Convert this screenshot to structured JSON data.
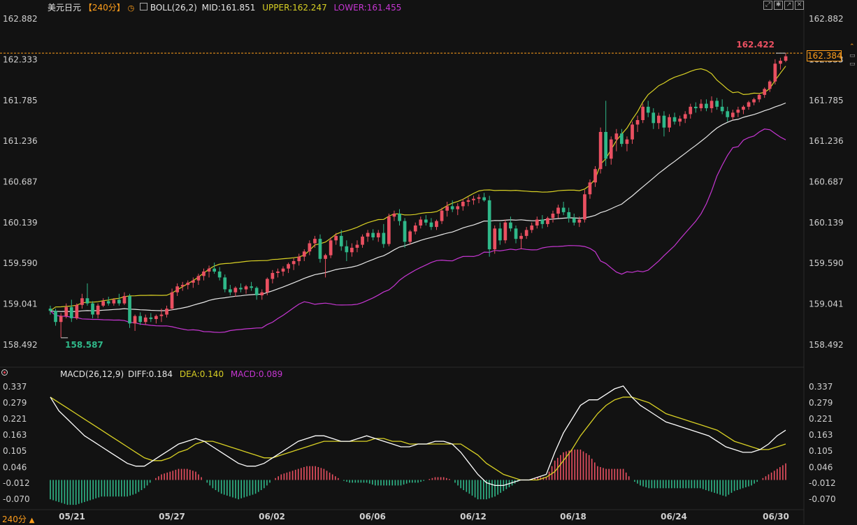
{
  "header": {
    "pair": "美元日元",
    "period": "【240分】",
    "period_icon": "clock-icon",
    "indicator_icon": "indicator-icon",
    "boll": "BOLL(26,2)",
    "mid": "MID:161.851",
    "upper": "UPPER:162.247",
    "lower": "LOWER:161.455"
  },
  "macd_header": {
    "name": "MACD(26,12,9)",
    "diff": "DIFF:0.184",
    "dea": "DEA:0.140",
    "macd": "MACD:0.089"
  },
  "toolbar_icons": [
    "maximize-icon",
    "settings-icon",
    "export-icon",
    "close-icon"
  ],
  "bottom_left": {
    "period": "240分",
    "arrow": "▲"
  },
  "price_axis": [
    "162.882",
    "162.333",
    "161.785",
    "161.236",
    "160.687",
    "160.139",
    "159.590",
    "159.041",
    "158.492"
  ],
  "macd_axis": [
    "0.337",
    "0.279",
    "0.221",
    "0.163",
    "0.105",
    "0.046",
    "-0.012",
    "-0.070"
  ],
  "current_price": "162.384",
  "high_label": "162.422",
  "low_label": "158.587",
  "dates": [
    "05/21",
    "05/27",
    "06/02",
    "06/06",
    "06/12",
    "06/18",
    "06/24",
    "06/30"
  ],
  "colors": {
    "bg": "#121212",
    "up": "#ea5061",
    "down": "#2fb889",
    "mid": "#e8e8e8",
    "upper": "#d8d024",
    "lower": "#c636d2",
    "diff": "#ffffff",
    "dea": "#d8d024",
    "macd_label": "#c636d2",
    "accent": "#ff9e1b"
  },
  "chart_data": [
    {
      "type": "candlestick",
      "title": "美元日元 240分",
      "ylim": [
        158.2,
        162.95
      ],
      "x_ticks": [
        "05/21",
        "05/27",
        "06/02",
        "06/06",
        "06/12",
        "06/18",
        "06/24",
        "06/30"
      ],
      "annotations": {
        "high": 162.422,
        "low": 158.587,
        "last": 162.384
      },
      "boll": {
        "mid": 161.851,
        "upper": 162.247,
        "lower": 161.455
      },
      "candles": [
        [
          158.98,
          159.02,
          158.9,
          158.95
        ],
        [
          158.95,
          158.98,
          158.75,
          158.8
        ],
        [
          158.8,
          158.92,
          158.59,
          158.88
        ],
        [
          158.88,
          159.05,
          158.85,
          159.0
        ],
        [
          159.0,
          159.1,
          158.8,
          158.85
        ],
        [
          158.85,
          159.05,
          158.83,
          159.03
        ],
        [
          159.03,
          159.18,
          158.98,
          159.12
        ],
        [
          159.12,
          159.32,
          159.02,
          159.05
        ],
        [
          159.05,
          159.08,
          158.85,
          158.9
        ],
        [
          158.9,
          159.05,
          158.85,
          159.02
        ],
        [
          159.02,
          159.12,
          159.0,
          159.08
        ],
        [
          159.08,
          159.14,
          159.02,
          159.05
        ],
        [
          159.05,
          159.12,
          159.02,
          159.1
        ],
        [
          159.1,
          159.18,
          159.02,
          159.05
        ],
        [
          159.05,
          159.2,
          159.03,
          159.15
        ],
        [
          159.15,
          159.18,
          158.72,
          158.78
        ],
        [
          158.78,
          158.9,
          158.68,
          158.88
        ],
        [
          158.88,
          158.93,
          158.76,
          158.8
        ],
        [
          158.8,
          158.9,
          158.76,
          158.86
        ],
        [
          158.86,
          158.92,
          158.8,
          158.84
        ],
        [
          158.84,
          158.9,
          158.78,
          158.88
        ],
        [
          158.88,
          158.98,
          158.8,
          158.9
        ],
        [
          158.9,
          159.02,
          158.86,
          158.98
        ],
        [
          158.98,
          159.25,
          158.96,
          159.2
        ],
        [
          159.2,
          159.32,
          159.15,
          159.28
        ],
        [
          159.28,
          159.34,
          159.22,
          159.3
        ],
        [
          159.3,
          159.36,
          159.24,
          159.33
        ],
        [
          159.33,
          159.4,
          159.26,
          159.36
        ],
        [
          159.36,
          159.45,
          159.3,
          159.42
        ],
        [
          159.42,
          159.52,
          159.36,
          159.48
        ],
        [
          159.48,
          159.56,
          159.4,
          159.52
        ],
        [
          159.52,
          159.6,
          159.45,
          159.48
        ],
        [
          159.48,
          159.54,
          159.36,
          159.4
        ],
        [
          159.4,
          159.44,
          159.2,
          159.24
        ],
        [
          159.24,
          159.3,
          159.16,
          159.2
        ],
        [
          159.2,
          159.28,
          159.14,
          159.26
        ],
        [
          159.26,
          159.32,
          159.2,
          159.24
        ],
        [
          159.24,
          159.3,
          159.18,
          159.28
        ],
        [
          159.28,
          159.34,
          159.22,
          159.26
        ],
        [
          159.26,
          159.28,
          159.1,
          159.16
        ],
        [
          159.16,
          159.24,
          159.1,
          159.2
        ],
        [
          159.2,
          159.4,
          159.16,
          159.38
        ],
        [
          159.38,
          159.5,
          159.32,
          159.46
        ],
        [
          159.46,
          159.52,
          159.4,
          159.48
        ],
        [
          159.48,
          159.55,
          159.42,
          159.52
        ],
        [
          159.52,
          159.6,
          159.46,
          159.58
        ],
        [
          159.58,
          159.66,
          159.5,
          159.62
        ],
        [
          159.62,
          159.72,
          159.56,
          159.68
        ],
        [
          159.68,
          159.78,
          159.62,
          159.75
        ],
        [
          159.75,
          159.9,
          159.7,
          159.86
        ],
        [
          159.86,
          159.96,
          159.8,
          159.92
        ],
        [
          159.92,
          159.98,
          159.6,
          159.65
        ],
        [
          159.65,
          159.72,
          159.4,
          159.7
        ],
        [
          159.7,
          159.94,
          159.66,
          159.9
        ],
        [
          159.9,
          160.0,
          159.84,
          159.96
        ],
        [
          159.96,
          160.04,
          159.76,
          159.82
        ],
        [
          159.82,
          159.9,
          159.62,
          159.74
        ],
        [
          159.74,
          159.86,
          159.68,
          159.8
        ],
        [
          159.8,
          159.9,
          159.74,
          159.84
        ],
        [
          159.84,
          159.98,
          159.8,
          159.95
        ],
        [
          159.95,
          160.04,
          159.88,
          160.0
        ],
        [
          160.0,
          160.05,
          159.9,
          159.94
        ],
        [
          159.94,
          160.04,
          159.88,
          160.0
        ],
        [
          160.0,
          160.12,
          159.8,
          159.85
        ],
        [
          159.85,
          160.26,
          159.82,
          160.22
        ],
        [
          160.22,
          160.3,
          160.16,
          160.26
        ],
        [
          160.26,
          160.32,
          160.1,
          160.16
        ],
        [
          160.16,
          160.2,
          159.8,
          159.88
        ],
        [
          159.88,
          160.04,
          159.84,
          160.02
        ],
        [
          160.02,
          160.14,
          159.98,
          160.1
        ],
        [
          160.1,
          160.22,
          160.06,
          160.18
        ],
        [
          160.18,
          160.24,
          160.1,
          160.14
        ],
        [
          160.14,
          160.2,
          160.04,
          160.08
        ],
        [
          160.08,
          160.18,
          160.04,
          160.16
        ],
        [
          160.16,
          160.34,
          160.12,
          160.3
        ],
        [
          160.3,
          160.42,
          160.22,
          160.36
        ],
        [
          160.36,
          160.44,
          160.28,
          160.32
        ],
        [
          160.32,
          160.4,
          160.24,
          160.36
        ],
        [
          160.36,
          160.46,
          160.3,
          160.42
        ],
        [
          160.42,
          160.48,
          160.36,
          160.44
        ],
        [
          160.44,
          160.5,
          160.38,
          160.46
        ],
        [
          160.46,
          160.52,
          160.4,
          160.48
        ],
        [
          160.48,
          160.54,
          160.42,
          160.44
        ],
        [
          160.44,
          160.5,
          159.68,
          159.78
        ],
        [
          159.78,
          160.1,
          159.72,
          160.06
        ],
        [
          160.06,
          160.14,
          159.84,
          159.9
        ],
        [
          159.9,
          160.18,
          159.86,
          160.14
        ],
        [
          160.14,
          160.22,
          160.02,
          160.06
        ],
        [
          160.06,
          160.1,
          159.86,
          159.92
        ],
        [
          159.92,
          160.0,
          159.78,
          159.96
        ],
        [
          159.96,
          160.08,
          159.92,
          160.04
        ],
        [
          160.04,
          160.14,
          160.0,
          160.1
        ],
        [
          160.1,
          160.22,
          160.06,
          160.18
        ],
        [
          160.18,
          160.24,
          160.06,
          160.12
        ],
        [
          160.12,
          160.22,
          160.08,
          160.2
        ],
        [
          160.2,
          160.3,
          160.14,
          160.26
        ],
        [
          160.26,
          160.38,
          160.2,
          160.34
        ],
        [
          160.34,
          160.42,
          160.24,
          160.28
        ],
        [
          160.28,
          160.34,
          160.14,
          160.2
        ],
        [
          160.2,
          160.26,
          160.1,
          160.14
        ],
        [
          160.14,
          160.22,
          160.08,
          160.18
        ],
        [
          160.18,
          160.58,
          160.14,
          160.52
        ],
        [
          160.52,
          160.72,
          160.46,
          160.68
        ],
        [
          160.68,
          160.9,
          160.62,
          160.86
        ],
        [
          160.86,
          161.42,
          160.8,
          161.36
        ],
        [
          161.36,
          161.78,
          160.9,
          161.0
        ],
        [
          161.0,
          161.3,
          160.92,
          161.26
        ],
        [
          161.26,
          161.4,
          161.1,
          161.34
        ],
        [
          161.34,
          161.4,
          161.16,
          161.2
        ],
        [
          161.2,
          161.3,
          161.1,
          161.26
        ],
        [
          161.26,
          161.5,
          161.2,
          161.46
        ],
        [
          161.46,
          161.58,
          161.36,
          161.52
        ],
        [
          161.52,
          161.74,
          161.48,
          161.7
        ],
        [
          161.7,
          161.78,
          161.56,
          161.62
        ],
        [
          161.62,
          161.68,
          161.4,
          161.48
        ],
        [
          161.48,
          161.62,
          161.4,
          161.58
        ],
        [
          161.58,
          161.64,
          161.3,
          161.42
        ],
        [
          161.42,
          161.6,
          161.36,
          161.56
        ],
        [
          161.56,
          161.62,
          161.46,
          161.5
        ],
        [
          161.5,
          161.58,
          161.44,
          161.54
        ],
        [
          161.54,
          161.64,
          161.48,
          161.6
        ],
        [
          161.6,
          161.74,
          161.54,
          161.7
        ],
        [
          161.7,
          161.76,
          161.62,
          161.68
        ],
        [
          161.68,
          161.8,
          161.64,
          161.74
        ],
        [
          161.74,
          161.8,
          161.64,
          161.68
        ],
        [
          161.68,
          161.84,
          161.62,
          161.78
        ],
        [
          161.78,
          161.82,
          161.66,
          161.7
        ],
        [
          161.7,
          161.8,
          161.6,
          161.64
        ],
        [
          161.64,
          161.7,
          161.5,
          161.56
        ],
        [
          161.56,
          161.66,
          161.52,
          161.62
        ],
        [
          161.62,
          161.7,
          161.56,
          161.66
        ],
        [
          161.66,
          161.72,
          161.6,
          161.7
        ],
        [
          161.7,
          161.78,
          161.66,
          161.76
        ],
        [
          161.76,
          161.82,
          161.72,
          161.8
        ],
        [
          161.8,
          161.88,
          161.76,
          161.86
        ],
        [
          161.86,
          161.96,
          161.82,
          161.94
        ],
        [
          161.94,
          162.06,
          161.9,
          162.04
        ],
        [
          162.04,
          162.34,
          162.0,
          162.28
        ],
        [
          162.28,
          162.36,
          162.2,
          162.32
        ],
        [
          162.32,
          162.42,
          162.3,
          162.38
        ]
      ]
    },
    {
      "type": "macd",
      "title": "MACD(26,12,9)",
      "ylim": [
        -0.105,
        0.355
      ],
      "x_ticks": [
        "05/21",
        "05/27",
        "06/02",
        "06/06",
        "06/12",
        "06/18",
        "06/24",
        "06/30"
      ],
      "series": [
        {
          "name": "DIFF",
          "values": [
            0.3,
            0.25,
            0.22,
            0.19,
            0.16,
            0.14,
            0.12,
            0.1,
            0.08,
            0.06,
            0.05,
            0.05,
            0.07,
            0.09,
            0.11,
            0.13,
            0.14,
            0.15,
            0.14,
            0.12,
            0.1,
            0.08,
            0.06,
            0.05,
            0.05,
            0.06,
            0.08,
            0.1,
            0.12,
            0.14,
            0.15,
            0.16,
            0.16,
            0.15,
            0.14,
            0.14,
            0.15,
            0.16,
            0.15,
            0.14,
            0.13,
            0.12,
            0.12,
            0.13,
            0.13,
            0.14,
            0.14,
            0.13,
            0.1,
            0.06,
            0.02,
            -0.01,
            -0.02,
            -0.02,
            -0.01,
            0.0,
            0.0,
            0.01,
            0.02,
            0.1,
            0.17,
            0.22,
            0.27,
            0.29,
            0.29,
            0.31,
            0.33,
            0.34,
            0.3,
            0.27,
            0.25,
            0.23,
            0.21,
            0.2,
            0.19,
            0.18,
            0.17,
            0.16,
            0.14,
            0.12,
            0.11,
            0.1,
            0.1,
            0.11,
            0.13,
            0.16,
            0.18
          ]
        },
        {
          "name": "DEA",
          "values": [
            0.3,
            0.28,
            0.26,
            0.24,
            0.22,
            0.2,
            0.18,
            0.16,
            0.14,
            0.12,
            0.1,
            0.08,
            0.07,
            0.07,
            0.08,
            0.1,
            0.11,
            0.13,
            0.14,
            0.14,
            0.13,
            0.12,
            0.11,
            0.1,
            0.09,
            0.08,
            0.08,
            0.09,
            0.1,
            0.11,
            0.12,
            0.13,
            0.14,
            0.14,
            0.14,
            0.14,
            0.14,
            0.14,
            0.15,
            0.15,
            0.14,
            0.14,
            0.13,
            0.13,
            0.13,
            0.13,
            0.13,
            0.13,
            0.13,
            0.11,
            0.09,
            0.06,
            0.04,
            0.02,
            0.01,
            0.0,
            0.0,
            0.0,
            0.01,
            0.03,
            0.07,
            0.11,
            0.16,
            0.2,
            0.24,
            0.27,
            0.29,
            0.3,
            0.3,
            0.29,
            0.28,
            0.26,
            0.24,
            0.23,
            0.22,
            0.21,
            0.2,
            0.19,
            0.18,
            0.16,
            0.14,
            0.13,
            0.12,
            0.11,
            0.11,
            0.12,
            0.13
          ]
        },
        {
          "name": "MACD",
          "values": [
            -0.07,
            -0.08,
            -0.09,
            -0.09,
            -0.08,
            -0.07,
            -0.06,
            -0.06,
            -0.06,
            -0.06,
            -0.05,
            -0.03,
            0.0,
            0.02,
            0.03,
            0.04,
            0.04,
            0.03,
            0.0,
            -0.03,
            -0.05,
            -0.06,
            -0.07,
            -0.06,
            -0.05,
            -0.03,
            0.0,
            0.02,
            0.03,
            0.04,
            0.05,
            0.05,
            0.04,
            0.02,
            0.0,
            -0.01,
            -0.01,
            -0.01,
            -0.02,
            -0.02,
            -0.02,
            -0.02,
            -0.01,
            -0.01,
            0.0,
            0.01,
            0.01,
            0.0,
            -0.03,
            -0.05,
            -0.07,
            -0.07,
            -0.06,
            -0.04,
            -0.02,
            0.0,
            0.0,
            0.01,
            0.01,
            0.07,
            0.1,
            0.11,
            0.11,
            0.09,
            0.05,
            0.04,
            0.04,
            0.04,
            0.0,
            -0.02,
            -0.03,
            -0.03,
            -0.03,
            -0.03,
            -0.03,
            -0.03,
            -0.03,
            -0.04,
            -0.05,
            -0.06,
            -0.04,
            -0.03,
            -0.02,
            0.0,
            0.02,
            0.04,
            0.06
          ]
        }
      ]
    }
  ]
}
